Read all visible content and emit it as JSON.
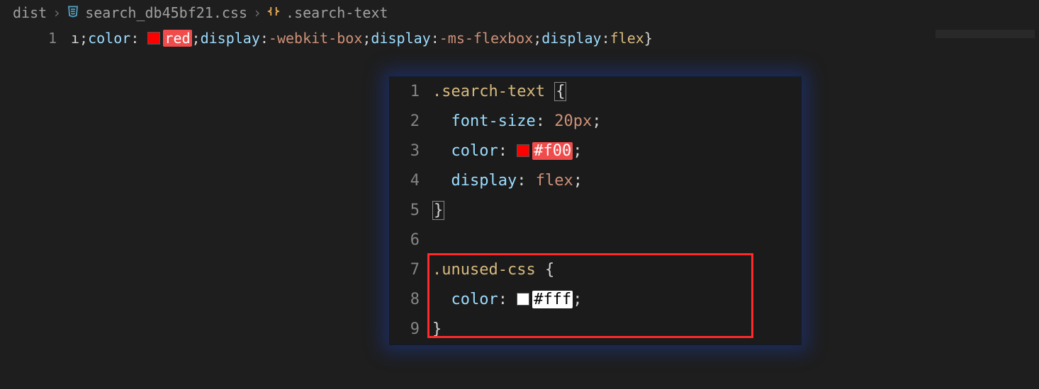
{
  "breadcrumb": {
    "folder": "dist",
    "file": "search_db45bf21.css",
    "symbol": ".search-text"
  },
  "editor": {
    "line_number": "1",
    "segments": {
      "lead": "ı",
      "p1": "color",
      "swatch1": "#ff0000",
      "v1": "red",
      "p2": "display",
      "v2": "-webkit-box",
      "p3": "display",
      "v3": "-ms-flexbox",
      "p4": "display",
      "v4": "flex"
    }
  },
  "peek": {
    "lines": [
      {
        "n": "1",
        "kind": "sel-open",
        "selector": ".search-text"
      },
      {
        "n": "2",
        "kind": "decl",
        "prop": "font-size",
        "val": "20px"
      },
      {
        "n": "3",
        "kind": "decl-color",
        "prop": "color",
        "swatch": "#ff0000",
        "val": "#f00",
        "hl": "red"
      },
      {
        "n": "4",
        "kind": "decl",
        "prop": "display",
        "val": "flex"
      },
      {
        "n": "5",
        "kind": "close"
      },
      {
        "n": "6",
        "kind": "blank"
      },
      {
        "n": "7",
        "kind": "sel-open2",
        "selector": ".unused-css"
      },
      {
        "n": "8",
        "kind": "decl-color",
        "prop": "color",
        "swatch": "#ffffff",
        "val": "#fff",
        "hl": "white"
      },
      {
        "n": "9",
        "kind": "close2"
      }
    ]
  }
}
